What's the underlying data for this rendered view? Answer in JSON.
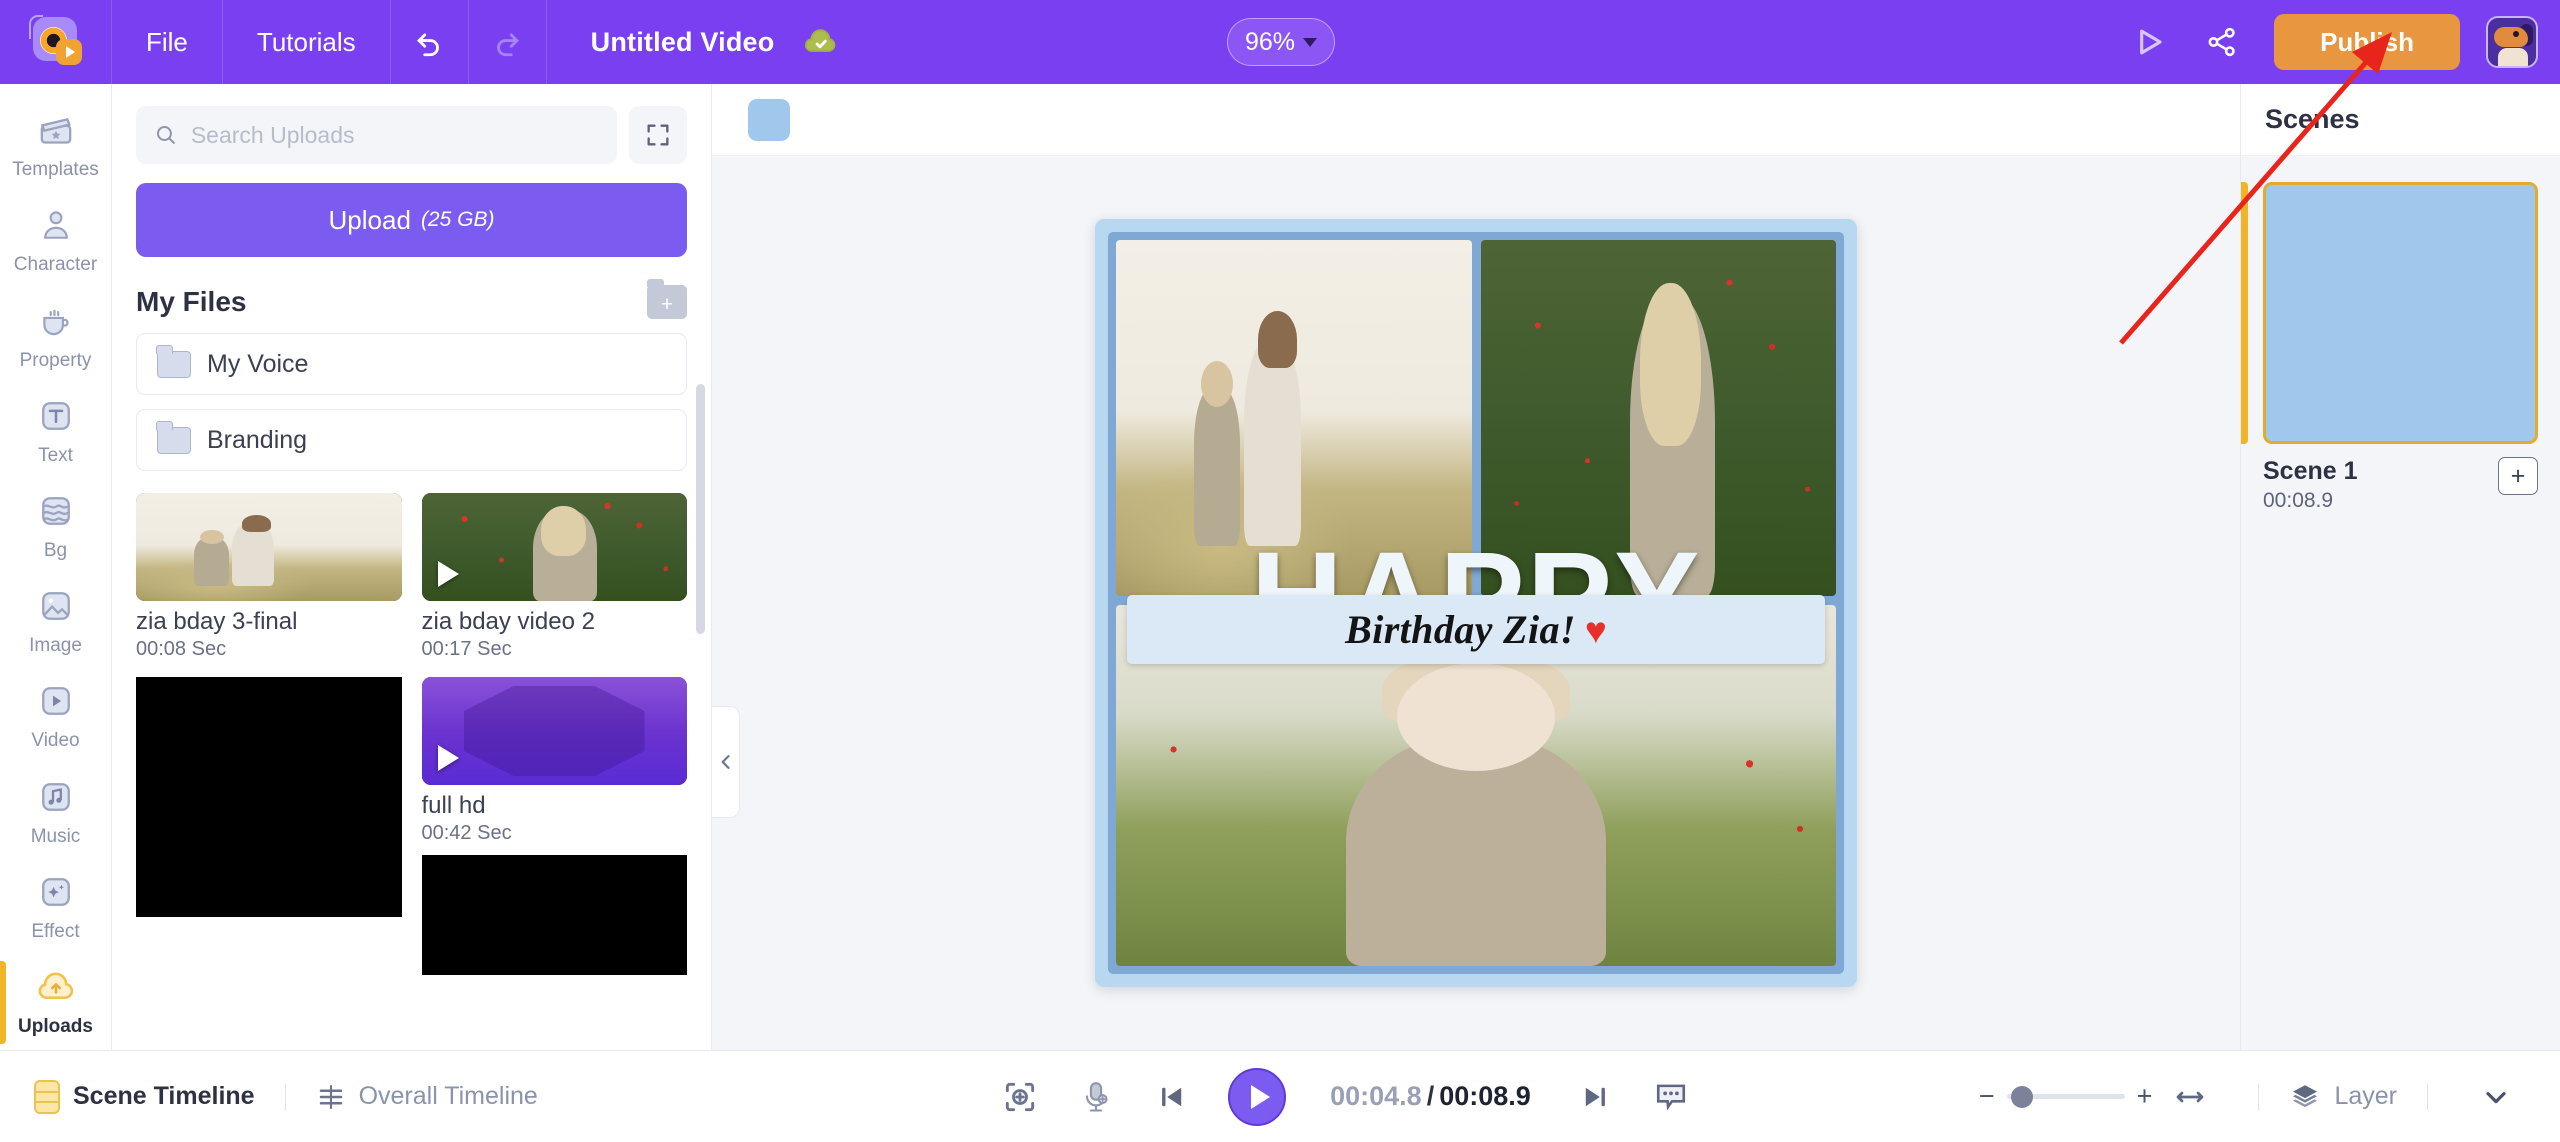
{
  "header": {
    "logo_icon": "app-logo-icon",
    "menu": [
      {
        "label": "File",
        "name": "file-menu"
      },
      {
        "label": "Tutorials",
        "name": "tutorials-menu"
      }
    ],
    "undo_icon": "undo-icon",
    "redo_icon": "redo-icon",
    "project_title": "Untitled Video",
    "saved_icon": "cloud-saved-icon",
    "zoom_level": "96%",
    "preview_icon": "preview-play-icon",
    "share_icon": "share-icon",
    "publish_label": "Publish",
    "avatar_icon": "user-avatar"
  },
  "rail": {
    "items": [
      {
        "label": "Templates",
        "icon": "clapperboard-icon",
        "active": false
      },
      {
        "label": "Character",
        "icon": "person-icon",
        "active": false
      },
      {
        "label": "Property",
        "icon": "cup-icon",
        "active": false
      },
      {
        "label": "Text",
        "icon": "text-t-icon",
        "active": false
      },
      {
        "label": "Bg",
        "icon": "layers-bg-icon",
        "active": false
      },
      {
        "label": "Image",
        "icon": "image-icon",
        "active": false
      },
      {
        "label": "Video",
        "icon": "video-play-icon",
        "active": false
      },
      {
        "label": "Music",
        "icon": "music-note-icon",
        "active": false
      },
      {
        "label": "Effect",
        "icon": "effect-sparkle-icon",
        "active": false
      },
      {
        "label": "Uploads",
        "icon": "cloud-upload-icon",
        "active": true
      }
    ]
  },
  "panel": {
    "search_placeholder": "Search Uploads",
    "search_value": "",
    "search_icon": "search-icon",
    "expand_icon": "expand-arrows-icon",
    "upload_label": "Upload",
    "upload_size": "(25 GB)",
    "my_files_title": "My Files",
    "add_folder_icon": "folder-plus-icon",
    "folders": [
      {
        "name": "My Voice",
        "icon": "folder-icon"
      },
      {
        "name": "Branding",
        "icon": "folder-icon"
      }
    ],
    "media": [
      {
        "name": "zia bday 3-final",
        "duration": "00:08 Sec",
        "art": "art-field",
        "play": false
      },
      {
        "name": "zia bday video 2",
        "duration": "00:17 Sec",
        "art": "art-poppy",
        "play": true
      },
      {
        "name": "",
        "duration": "",
        "art": "art-black",
        "play": false
      },
      {
        "name": "full hd",
        "duration": "00:42 Sec",
        "art": "art-hex",
        "play": true
      },
      {
        "name": "",
        "duration": "",
        "art": "art-black",
        "play": false
      },
      {
        "name": "",
        "duration": "",
        "art": "art-black",
        "play": false
      }
    ],
    "collapse_icon": "chevron-left-icon"
  },
  "canvas": {
    "color_chip": "#9fc8ec",
    "overlay_title": "HAPPY",
    "banner_text": "Birthday Zia!",
    "banner_emoji": "♥",
    "banner_bg": "#dbe9f7",
    "frame_color": "#7fa9d4",
    "border_color": "#b8d8f2"
  },
  "scenes": {
    "title": "Scenes",
    "items": [
      {
        "name": "Scene 1",
        "duration": "00:08.9",
        "color": "#9fc8ec",
        "active": true
      }
    ],
    "add_scene_icon": "plus-icon",
    "add_scene_label": "+"
  },
  "footer": {
    "scene_timeline_label": "Scene Timeline",
    "scene_timeline_icon": "scene-timeline-icon",
    "overall_timeline_label": "Overall Timeline",
    "overall_timeline_icon": "overall-timeline-icon",
    "fit_icon": "fit-selection-icon",
    "mic_icon": "microphone-record-icon",
    "prev_icon": "skip-previous-icon",
    "play_icon": "play-icon",
    "next_icon": "skip-next-icon",
    "caption_icon": "subtitle-bubble-icon",
    "current_time": "00:04.8",
    "time_separator": "/",
    "total_time": "00:08.9",
    "zoom_minus": "−",
    "zoom_plus": "+",
    "fit_width_icon": "fit-width-icon",
    "layer_label": "Layer",
    "layer_icon": "layers-stack-icon",
    "chevron_icon": "chevron-down-icon"
  },
  "annotation": {
    "arrow_color": "#e8251b"
  }
}
